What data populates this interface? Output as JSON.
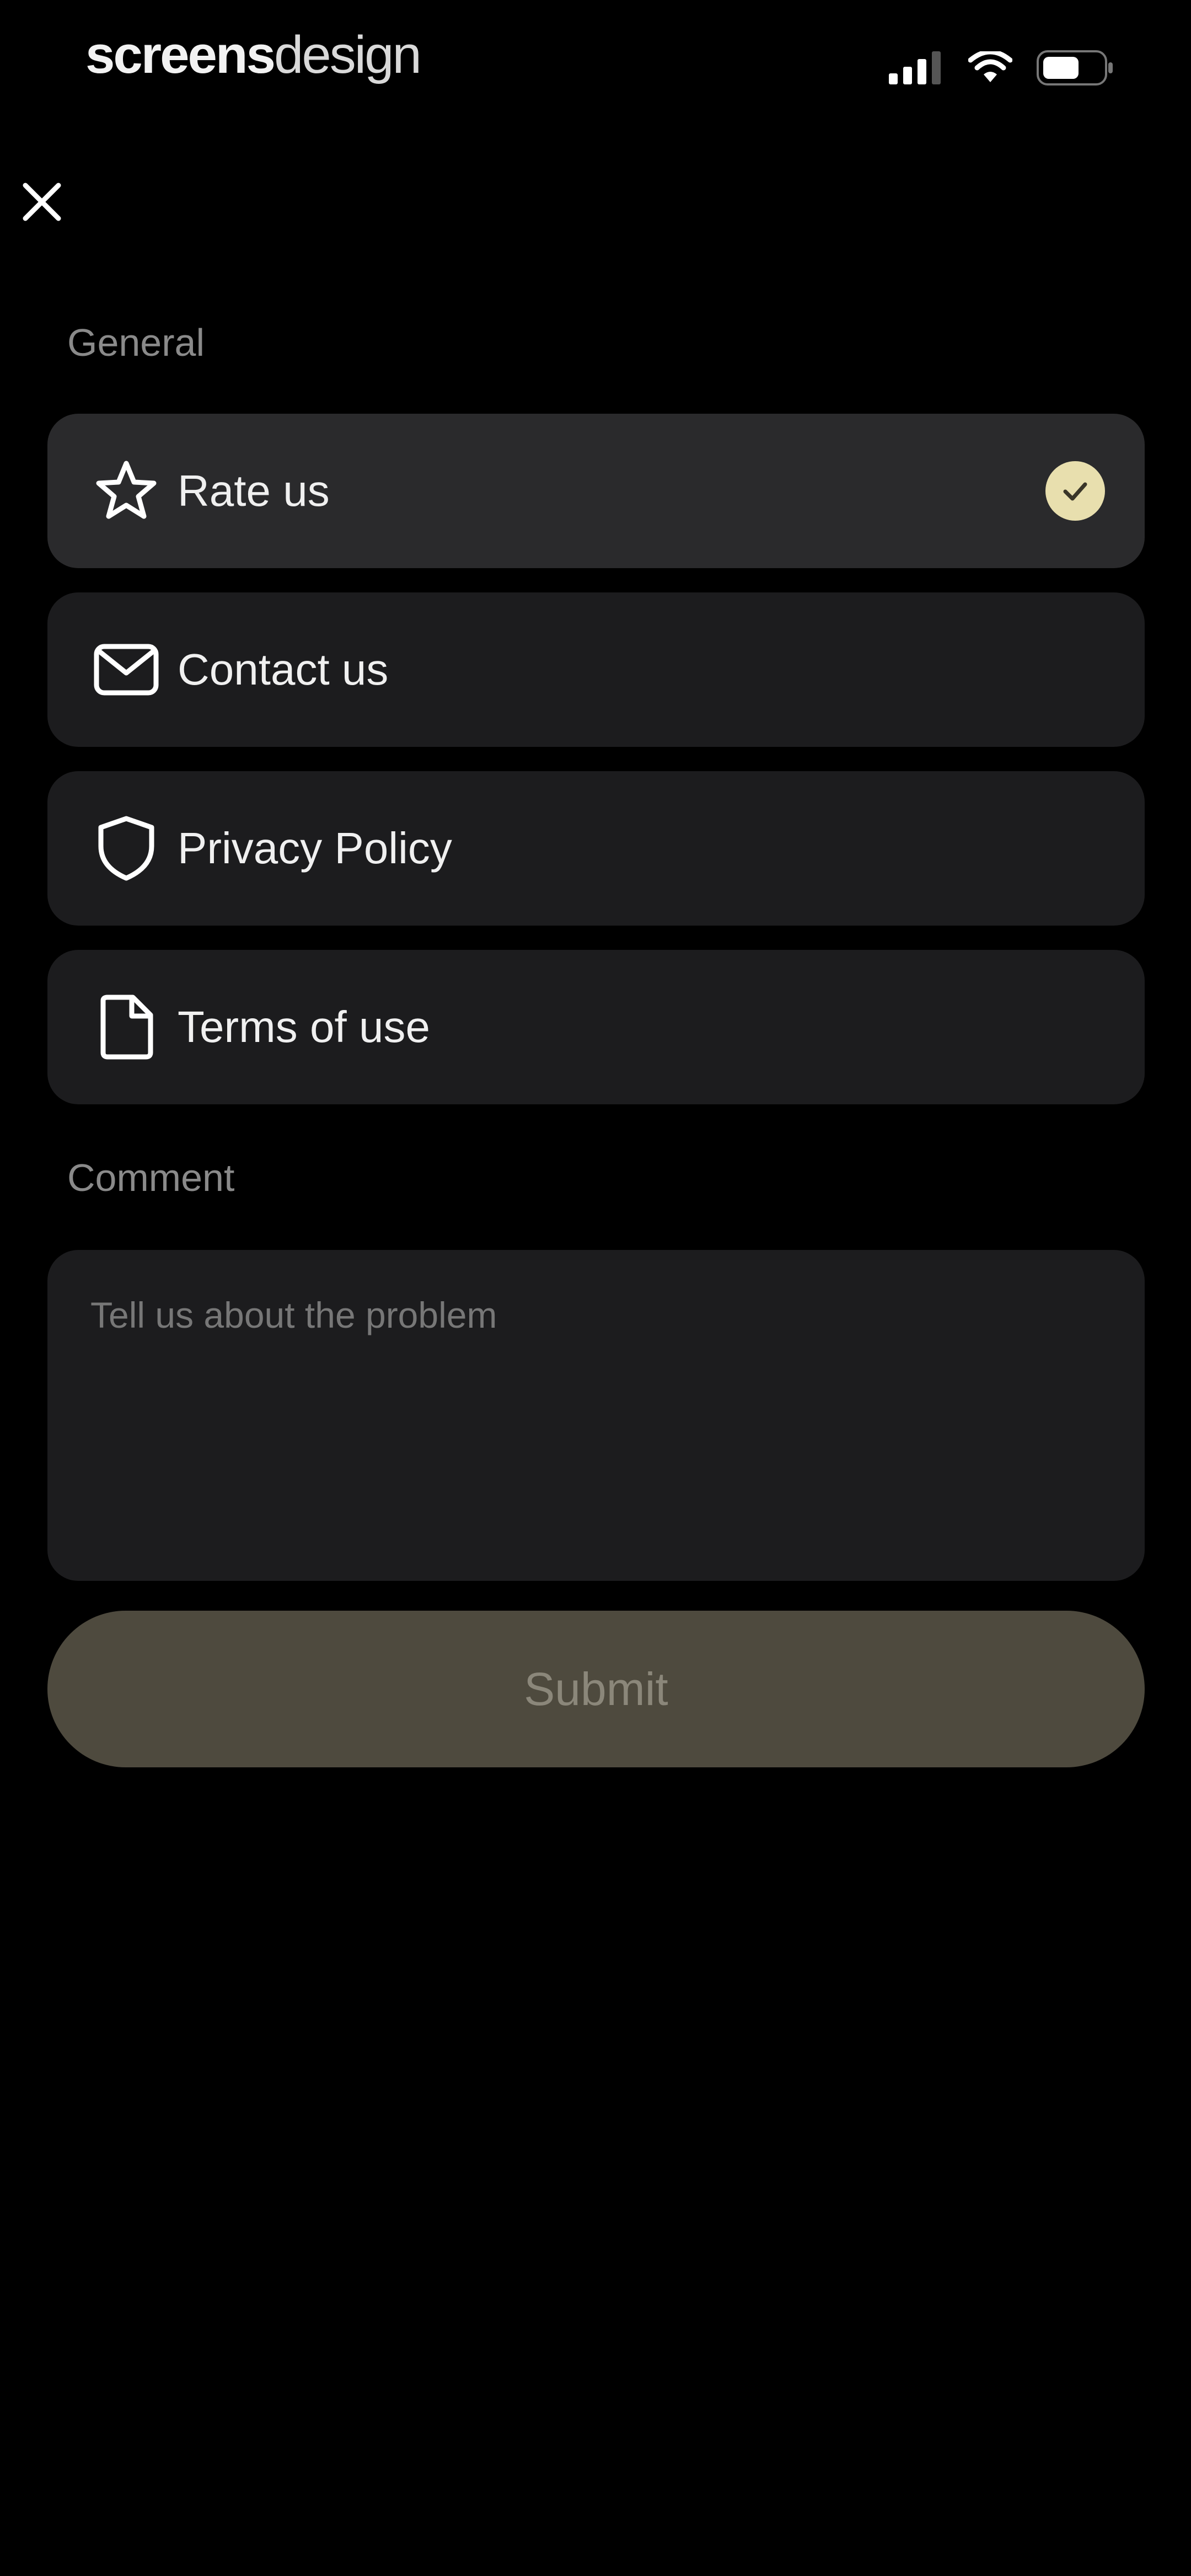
{
  "status_bar": {
    "brand_bold": "screens",
    "brand_light": "design",
    "signal_icon": "cellular-signal-icon",
    "wifi_icon": "wifi-icon",
    "battery_icon": "battery-icon"
  },
  "header": {
    "close_icon": "close-icon"
  },
  "general": {
    "section_label": "General",
    "items": [
      {
        "label": "Rate us",
        "icon": "star-icon",
        "selected": true
      },
      {
        "label": "Contact us",
        "icon": "mail-icon",
        "selected": false
      },
      {
        "label": "Privacy Policy",
        "icon": "shield-icon",
        "selected": false
      },
      {
        "label": "Terms of use",
        "icon": "document-icon",
        "selected": false
      }
    ]
  },
  "comment": {
    "section_label": "Comment",
    "placeholder": "Tell us about the problem",
    "value": ""
  },
  "submit": {
    "label": "Submit"
  },
  "colors": {
    "background": "#000000",
    "card": "#1c1c1e",
    "card_active": "#2a2a2c",
    "accent_check": "#e8dfae",
    "submit_bg": "#4e4a3e",
    "submit_text": "#8b877a",
    "muted_text": "#8a8a8a"
  }
}
